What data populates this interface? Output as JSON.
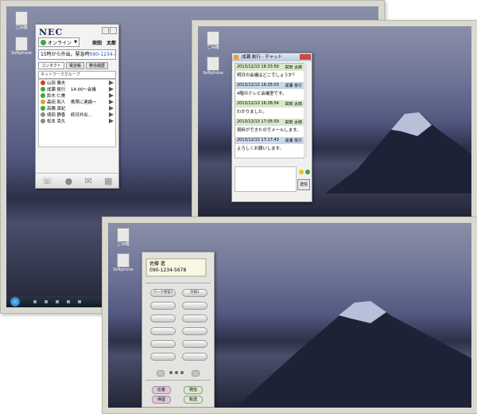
{
  "colors": {
    "accent": "#1f2a55",
    "online": "#3ca63c",
    "chat_header_a": "#d6e8c8",
    "chat_header_b": "#cad9ea",
    "call_button": "#e2c5dc",
    "send_button": "#d9ebc8"
  },
  "desktop": {
    "icons": [
      {
        "label": "ごみ箱",
        "icon": "recycle-bin-icon"
      },
      {
        "label": "Softphone",
        "icon": "app-shortcut-icon"
      }
    ]
  },
  "phone_panel": {
    "brand": "NEC",
    "status": {
      "label": "オンライン",
      "icon": "online-status-icon"
    },
    "user_name": "栄田　太郎",
    "message": "15時から外出。緊急時",
    "phone_number": "090-1234-xxxx",
    "tabs": [
      "コンタクト",
      "電話帳",
      "着信履歴"
    ],
    "group": "ネットワークグループ",
    "contacts": [
      {
        "name": "山田 雅夫",
        "note": "",
        "status": "#d9372f"
      },
      {
        "name": "成瀬 俊行",
        "note": "14:00〜会議",
        "status": "#3ca63c"
      },
      {
        "name": "鈴木 仁美",
        "note": "",
        "status": "#3ca63c"
      },
      {
        "name": "森田 和人",
        "note": "携帯に連絡〜",
        "status": "#e0a520"
      },
      {
        "name": "高橋 真紀",
        "note": "",
        "status": "#3ca63c"
      },
      {
        "name": "靖田 静香",
        "note": "終日外出…",
        "status": "#8c8c8c"
      },
      {
        "name": "松本 幸久",
        "note": "",
        "status": "#8c8c8c"
      }
    ],
    "bottom_icons": [
      "phone-icon",
      "chat-icon",
      "mail-icon",
      "keypad-icon"
    ]
  },
  "chat_window": {
    "title": "成瀬 俊行 - チャット",
    "messages": [
      {
        "time": "2013/12/13 16:33:50",
        "sender": "栄田 太郎",
        "text": "明日の会議はどこでしょうか？",
        "style": "a"
      },
      {
        "time": "2013/12/13 16:35:03",
        "sender": "成瀬 俊行",
        "text": "4階のテレビ会議室です。",
        "style": "b"
      },
      {
        "time": "2013/12/13 16:38:54",
        "sender": "栄田 太郎",
        "text": "わかりました。",
        "style": "a"
      },
      {
        "time": "2013/12/13 17:05:59",
        "sender": "栄田 太郎",
        "text": "資料ができたのでメールします。",
        "style": "a"
      },
      {
        "time": "2013/12/13 17:17:43",
        "sender": "成瀬 俊行",
        "text": "よろしくお願いします。",
        "style": "b"
      }
    ],
    "send_label": "送信"
  },
  "dialpad": {
    "callee_name": "佐藤 進",
    "callee_number": "090-1234-5678",
    "keys": [
      "パーク保留1",
      "外線1",
      "",
      "",
      "",
      "",
      "",
      "",
      "",
      "",
      "",
      ""
    ],
    "buttons": {
      "answer": "応答",
      "call": "発信",
      "hold": "保留",
      "transfer": "転送"
    }
  }
}
